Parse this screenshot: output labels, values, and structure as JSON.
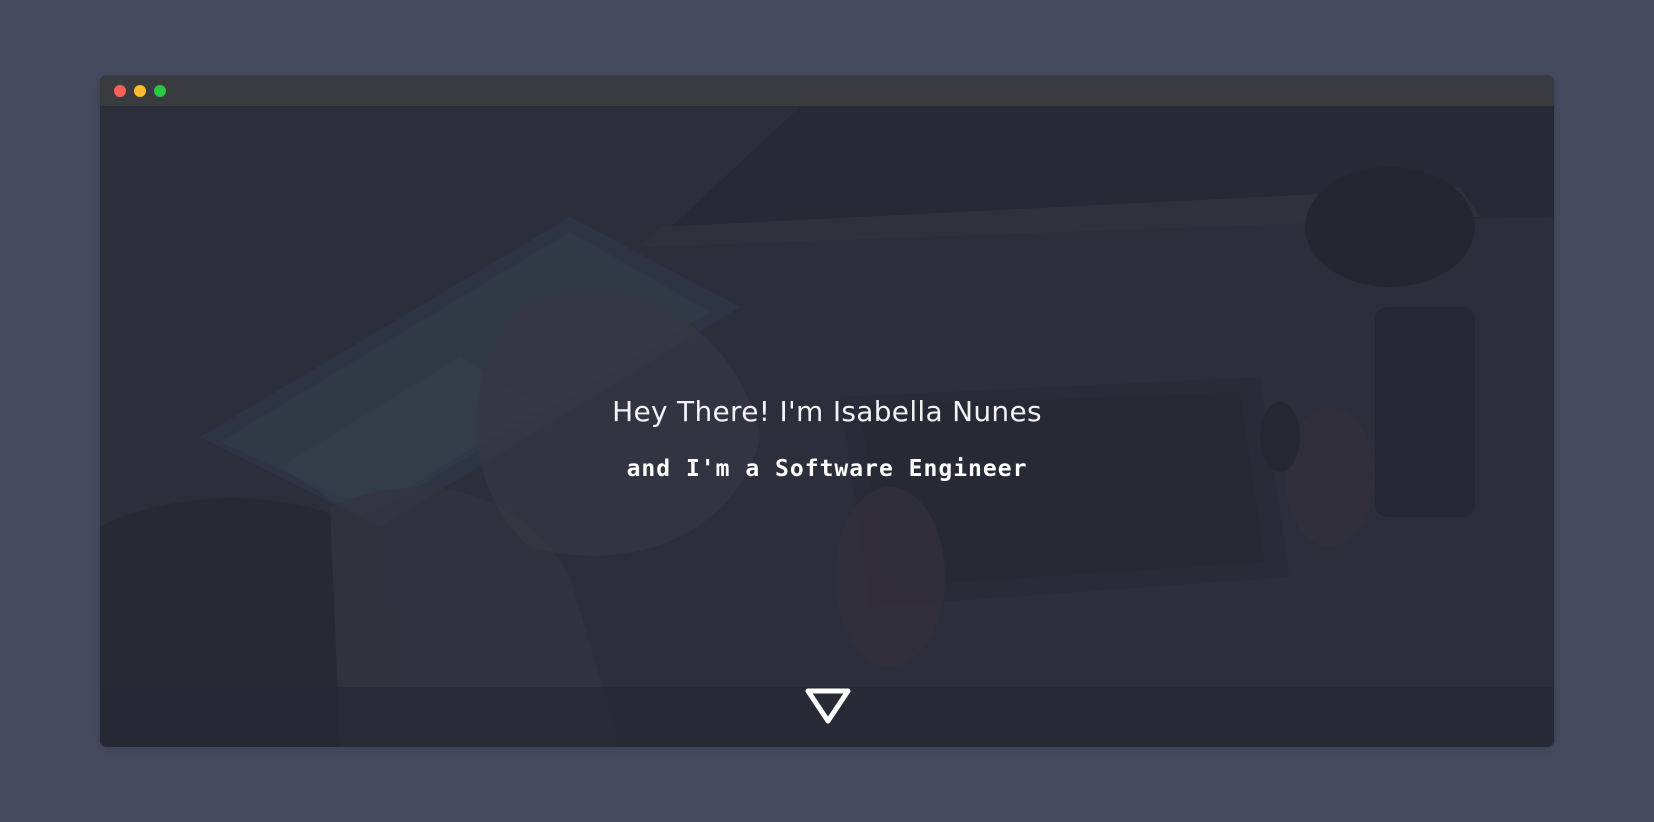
{
  "window": {
    "controls": [
      {
        "name": "close",
        "color": "#ff5f57"
      },
      {
        "name": "minimize",
        "color": "#febc2e"
      },
      {
        "name": "maximize",
        "color": "#28c840"
      }
    ]
  },
  "hero": {
    "title": "Hey There! I'm Isabella Nunes",
    "subtitle": "and I'm a Software Engineer",
    "scroll_icon": "down-triangle-icon",
    "background_image": "top-down-desk-with-laptop-and-hands-photo"
  },
  "colors": {
    "page_background": "#454a5e",
    "titlebar": "#3a3b3e",
    "hero_overlay": "#2c2e3b",
    "text": "#ffffff"
  }
}
